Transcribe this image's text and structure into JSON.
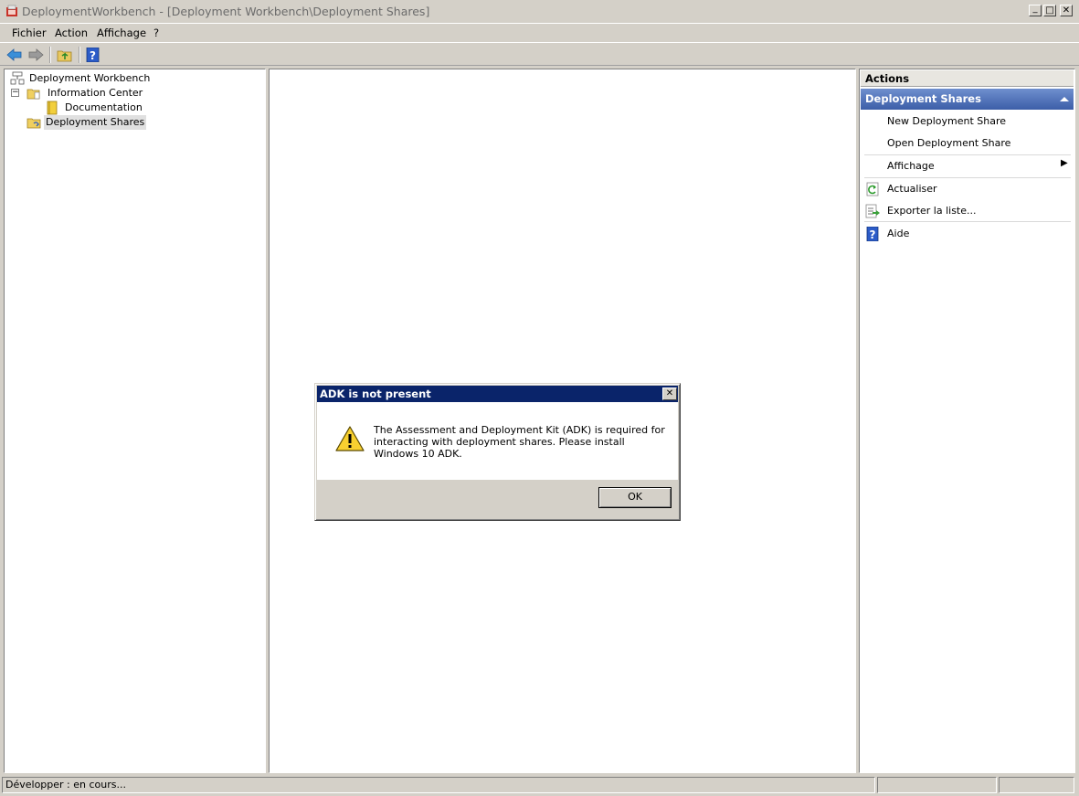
{
  "window": {
    "title": "DeploymentWorkbench - [Deployment Workbench\\Deployment Shares]",
    "minimize": "_",
    "maximize": "□",
    "close": "✕"
  },
  "menu": {
    "items": [
      "Fichier",
      "Action",
      "Affichage",
      "?"
    ]
  },
  "toolbar": {
    "icons": [
      "back-arrow-icon",
      "forward-arrow-icon",
      "up-folder-icon",
      "help-icon"
    ]
  },
  "tree": {
    "items": [
      {
        "label": "Deployment Workbench",
        "icon": "workbench-icon"
      },
      {
        "label": "Information Center",
        "icon": "folder-icon",
        "expander": "−"
      },
      {
        "label": "Documentation",
        "icon": "book-icon"
      },
      {
        "label": "Deployment Shares",
        "icon": "shared-folder-icon",
        "selected": true
      }
    ]
  },
  "actions": {
    "header": "Actions",
    "section": "Deployment Shares",
    "items": [
      {
        "label": "New Deployment Share"
      },
      {
        "label": "Open Deployment Share"
      },
      {
        "label": "Affichage",
        "submenu": "▶"
      },
      {
        "label": "Actualiser",
        "icon": "refresh-icon"
      },
      {
        "label": "Exporter la liste...",
        "icon": "export-list-icon"
      },
      {
        "label": "Aide",
        "icon": "help-icon"
      }
    ]
  },
  "status": {
    "text": "Développer :  en cours...",
    "cell2": "",
    "cell3": ""
  },
  "dialog": {
    "title": "ADK is not present",
    "close": "✕",
    "message": "The Assessment and Deployment Kit (ADK) is required for interacting with deployment shares.  Please install Windows 10 ADK.",
    "icon": "warning-icon",
    "ok_label": "OK"
  },
  "colors": {
    "face": "#d4d0c8",
    "dialog_title": "#0a246a",
    "actions_section": "#4a6cb3",
    "selection": "#e0e0e0"
  }
}
